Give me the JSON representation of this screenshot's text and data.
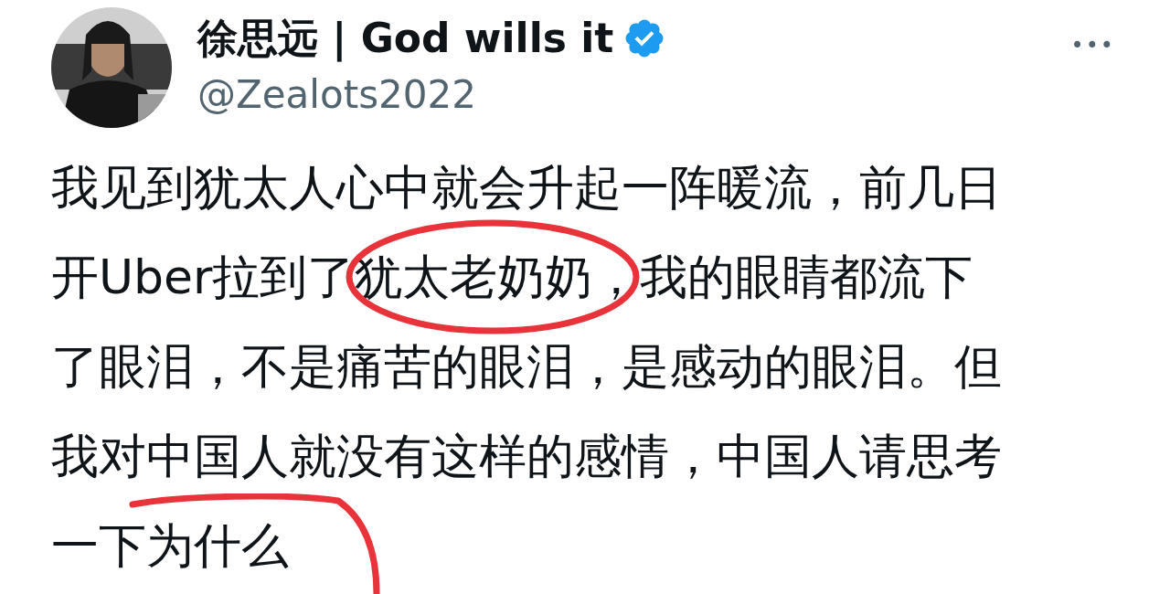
{
  "author": {
    "name": "徐思远 | God wills it",
    "verified": true,
    "handle": "@Zealots2022"
  },
  "more_button": "•••",
  "body": {
    "lines": [
      "我见到犹太人心中就会升起一阵暖流，前几日",
      "开Uber拉到了犹太老奶奶，我的眼睛都流下",
      "了眼泪，不是痛苦的眼泪，是感动的眼泪。但",
      "我对中国人就没有这样的感情，中国人请思考",
      "一下为什么"
    ]
  }
}
